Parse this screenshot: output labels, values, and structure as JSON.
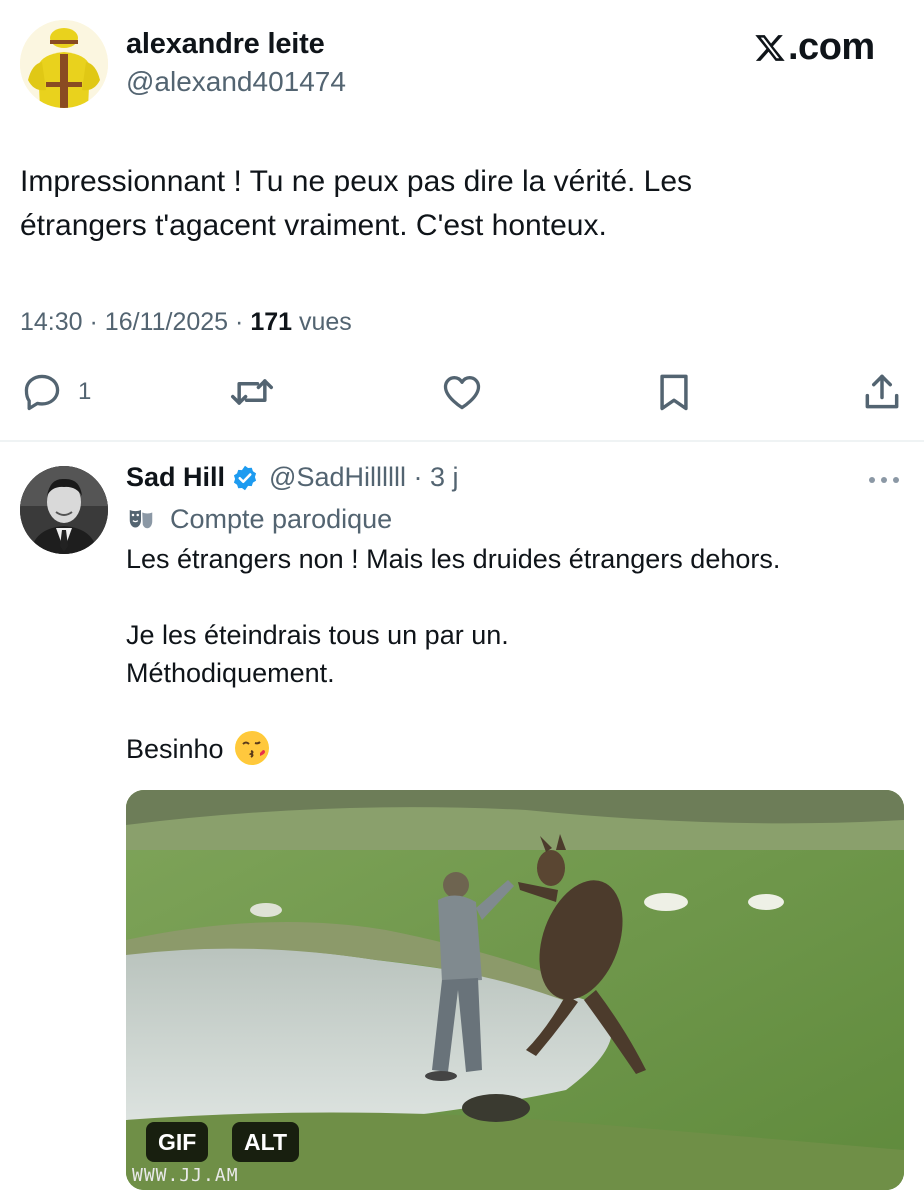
{
  "main_tweet": {
    "author_name": "alexandre leite",
    "handle": "@alexand401474",
    "brand": ".com",
    "text_line1": "Impressionnant ! Tu ne peux pas dire la vérité. Les",
    "text_line2": "étrangers t'agacent vraiment. C'est honteux.",
    "time": "14:30",
    "date": "16/11/2025",
    "views_count": "171",
    "views_label": "vues",
    "actions": {
      "reply_icon": "reply-icon",
      "reply_count": "1",
      "retweet_icon": "retweet-icon",
      "like_icon": "heart-icon",
      "bookmark_icon": "bookmark-icon",
      "share_icon": "share-icon"
    }
  },
  "reply": {
    "author_name": "Sad Hill",
    "verified_icon": "verified-badge-icon",
    "handle": "@SadHillllll",
    "age": "3 j",
    "parody_label": "Compte parodique",
    "line1": "Les étrangers non ! Mais les druides étrangers dehors.",
    "line2": "Je les éteindrais tous un par un.",
    "line3": "Méthodiquement.",
    "line4": "Besinho",
    "media": {
      "gif_badge": "GIF",
      "alt_badge": "ALT",
      "watermark": "WWW.JJ.AM"
    }
  },
  "colors": {
    "text": "#0f1419",
    "secondary": "#536471",
    "verified": "#1d9bf0",
    "divider": "#eff3f4"
  }
}
